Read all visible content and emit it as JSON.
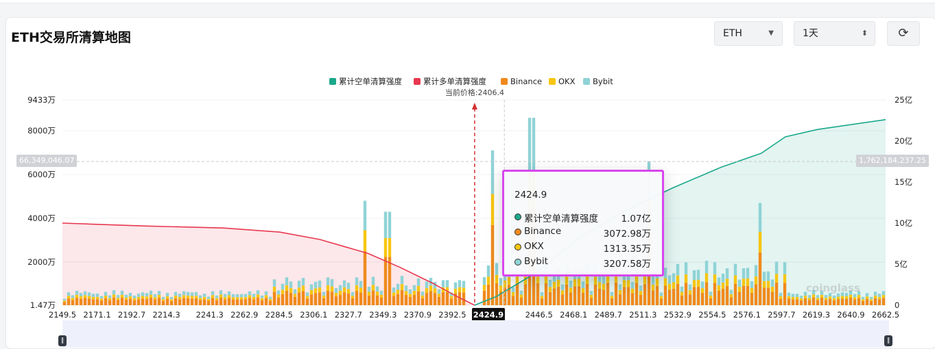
{
  "header": {
    "title": "ETH交易所清算地图",
    "coin_select": "ETH",
    "period_select": "1天"
  },
  "icons": {
    "coin_caret": "caret-down-icon",
    "period_updown": "updown-icon",
    "refresh": "refresh-icon"
  },
  "chart_data": {
    "type": "bar",
    "current_price_label": "当前价格:2406.4",
    "current_price": 2406.4,
    "hover_x": "2424.9",
    "left_axis": {
      "ticks": [
        {
          "label": "9433万",
          "value": 9433
        },
        {
          "label": "8000万",
          "value": 8000
        },
        {
          "label": "6000万",
          "value": 6000
        },
        {
          "label": "4000万",
          "value": 4000
        },
        {
          "label": "2000万",
          "value": 2000
        },
        {
          "label": "1.47万",
          "value": 1.47
        }
      ]
    },
    "right_axis": {
      "ticks": [
        "25亿",
        "20亿",
        "15亿",
        "10亿",
        "5亿",
        "0"
      ],
      "max": 25
    },
    "x_ticks": [
      "2149.5",
      "2171.1",
      "2192.7",
      "2214.3",
      "2241.3",
      "2262.9",
      "2284.5",
      "2306.1",
      "2327.7",
      "2349.3",
      "2370.9",
      "2392.5",
      "2424.9",
      "2446.5",
      "2468.1",
      "2489.7",
      "2511.3",
      "2532.9",
      "2554.5",
      "2576.1",
      "2597.7",
      "2619.3",
      "2640.9",
      "2662.5"
    ],
    "x_min": 2149.5,
    "x_max": 2662.5,
    "series": [
      {
        "name": "累计空单清算强度",
        "color": "#1aa88a",
        "kind": "cumulative-short"
      },
      {
        "name": "累计多单清算强度",
        "color": "#e8384f",
        "kind": "cumulative-long"
      },
      {
        "name": "Binance",
        "color": "#f08a1c",
        "kind": "bar"
      },
      {
        "name": "OKX",
        "color": "#f7c611",
        "kind": "bar"
      },
      {
        "name": "Bybit",
        "color": "#8fd3d6",
        "kind": "bar"
      }
    ],
    "cumulative_long_yi": [
      [
        2149.5,
        10.0
      ],
      [
        2200,
        9.65
      ],
      [
        2250,
        9.4
      ],
      [
        2285,
        8.9
      ],
      [
        2310,
        8.0
      ],
      [
        2340,
        6.3
      ],
      [
        2360,
        4.6
      ],
      [
        2380,
        2.7
      ],
      [
        2395,
        1.1
      ],
      [
        2406.4,
        0
      ]
    ],
    "cumulative_short_yi": [
      [
        2406.4,
        0
      ],
      [
        2420,
        1.07
      ],
      [
        2445,
        4.0
      ],
      [
        2470,
        8.0
      ],
      [
        2500,
        11.5
      ],
      [
        2530,
        14.3
      ],
      [
        2560,
        16.8
      ],
      [
        2585,
        18.5
      ],
      [
        2600,
        20.5
      ],
      [
        2620,
        21.4
      ],
      [
        2662.5,
        22.6
      ]
    ],
    "bar_peaks_wan": [
      {
        "x": 2339,
        "total": 4800
      },
      {
        "x": 2352,
        "total": 4300
      },
      {
        "x": 2418,
        "total": 7100
      },
      {
        "x": 2442,
        "total": 8600
      },
      {
        "x": 2515,
        "total": 6600
      },
      {
        "x": 2585,
        "total": 4700
      }
    ],
    "crosshair_left_value": "66,349,046.07",
    "crosshair_right_value": "1,762,184,237.25",
    "tooltip": {
      "title": "2424.9",
      "rows": [
        {
          "name": "累计空单清算强度",
          "value": "1.07亿",
          "color": "#1aa88a"
        },
        {
          "name": "Binance",
          "value": "3072.98万",
          "color": "#f08a1c"
        },
        {
          "name": "OKX",
          "value": "1313.35万",
          "color": "#f7c611"
        },
        {
          "name": "Bybit",
          "value": "3207.58万",
          "color": "#8fd3d6"
        }
      ]
    },
    "watermark": "coinglass"
  }
}
